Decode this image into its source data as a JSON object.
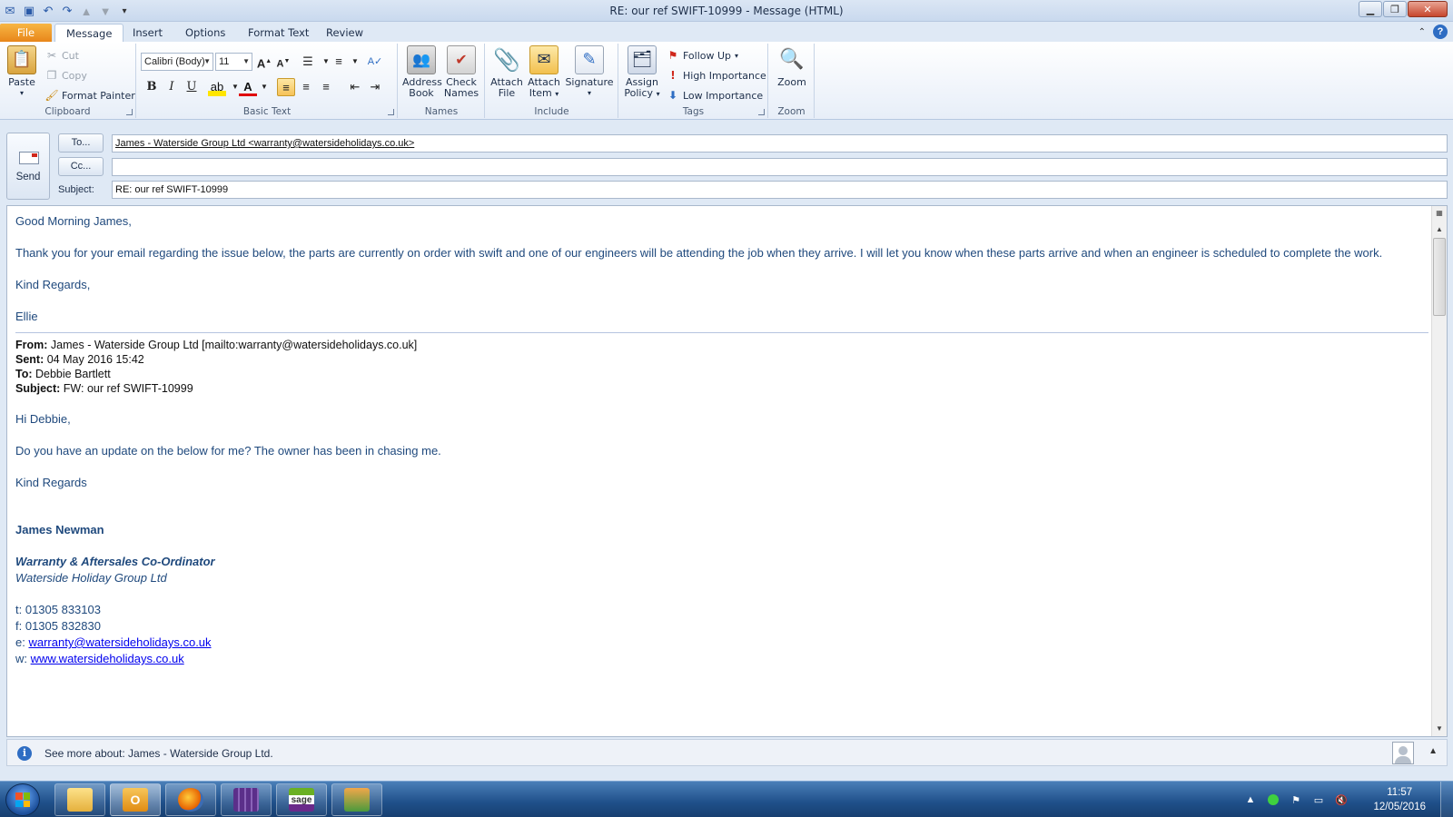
{
  "window": {
    "title": "RE: our ref SWIFT-10999  -  Message (HTML)"
  },
  "tabs": [
    "File",
    "Message",
    "Insert",
    "Options",
    "Format Text",
    "Review"
  ],
  "ribbon": {
    "clipboard": {
      "label": "Clipboard",
      "paste": "Paste",
      "cut": "Cut",
      "copy": "Copy",
      "format_painter": "Format Painter"
    },
    "basic_text": {
      "label": "Basic Text",
      "font": "Calibri (Body)",
      "size": "11"
    },
    "names": {
      "label": "Names",
      "address_book_1": "Address",
      "address_book_2": "Book",
      "check_names_1": "Check",
      "check_names_2": "Names"
    },
    "include": {
      "label": "Include",
      "attach_file_1": "Attach",
      "attach_file_2": "File",
      "attach_item_1": "Attach",
      "attach_item_2": "Item",
      "signature": "Signature"
    },
    "tags": {
      "label": "Tags",
      "assign_policy_1": "Assign",
      "assign_policy_2": "Policy",
      "follow_up": "Follow Up",
      "high_importance": "High Importance",
      "low_importance": "Low Importance"
    },
    "zoom": {
      "label": "Zoom",
      "zoom": "Zoom"
    }
  },
  "header": {
    "send": "Send",
    "to_button": "To...",
    "cc_button": "Cc...",
    "subject_label": "Subject:",
    "to_value": "James - Waterside Group Ltd <warranty@watersideholidays.co.uk>",
    "cc_value": "",
    "subject_value": "RE: our ref SWIFT-10999"
  },
  "body": {
    "greeting": "Good Morning James,",
    "para1": "Thank you for your email regarding the issue below, the parts are currently on order with swift and one of our engineers will be attending the job when they arrive. I will let you know when these parts arrive and when an engineer is scheduled to complete the work.",
    "regards": "Kind Regards,",
    "signoff": "Ellie",
    "quoted": {
      "from_label": "From:",
      "from": "James - Waterside Group Ltd [mailto:warranty@watersideholidays.co.uk]",
      "sent_label": "Sent:",
      "sent": "04 May 2016 15:42",
      "to_label": "To:",
      "to": "Debbie Bartlett",
      "subject_label": "Subject:",
      "subject": "FW: our ref SWIFT-10999",
      "greeting": "Hi Debbie,",
      "para": "Do you have an update on the below for me? The owner has been in chasing me.",
      "regards": "Kind Regards",
      "sig_name": "James Newman",
      "sig_title": "Warranty & Aftersales Co-Ordinator",
      "sig_company": "Waterside Holiday Group Ltd",
      "phone": "t: 01305 833103",
      "fax": "f: 01305 832830",
      "email_prefix": "e: ",
      "email": "warranty@watersideholidays.co.uk",
      "web_prefix": "w: ",
      "web": "www.watersideholidays.co.uk"
    }
  },
  "people_pane": {
    "text": "See more about: James - Waterside Group Ltd."
  },
  "taskbar": {
    "apps": [
      "explorer",
      "outlook",
      "firefox",
      "calculator-app",
      "sage",
      "people-app"
    ],
    "sage_label": "sage",
    "time": "11:57",
    "date": "12/05/2016"
  },
  "colors": {
    "body_text": "#1f497d",
    "link": "#0000ee",
    "file_tab": "#e8861a"
  }
}
